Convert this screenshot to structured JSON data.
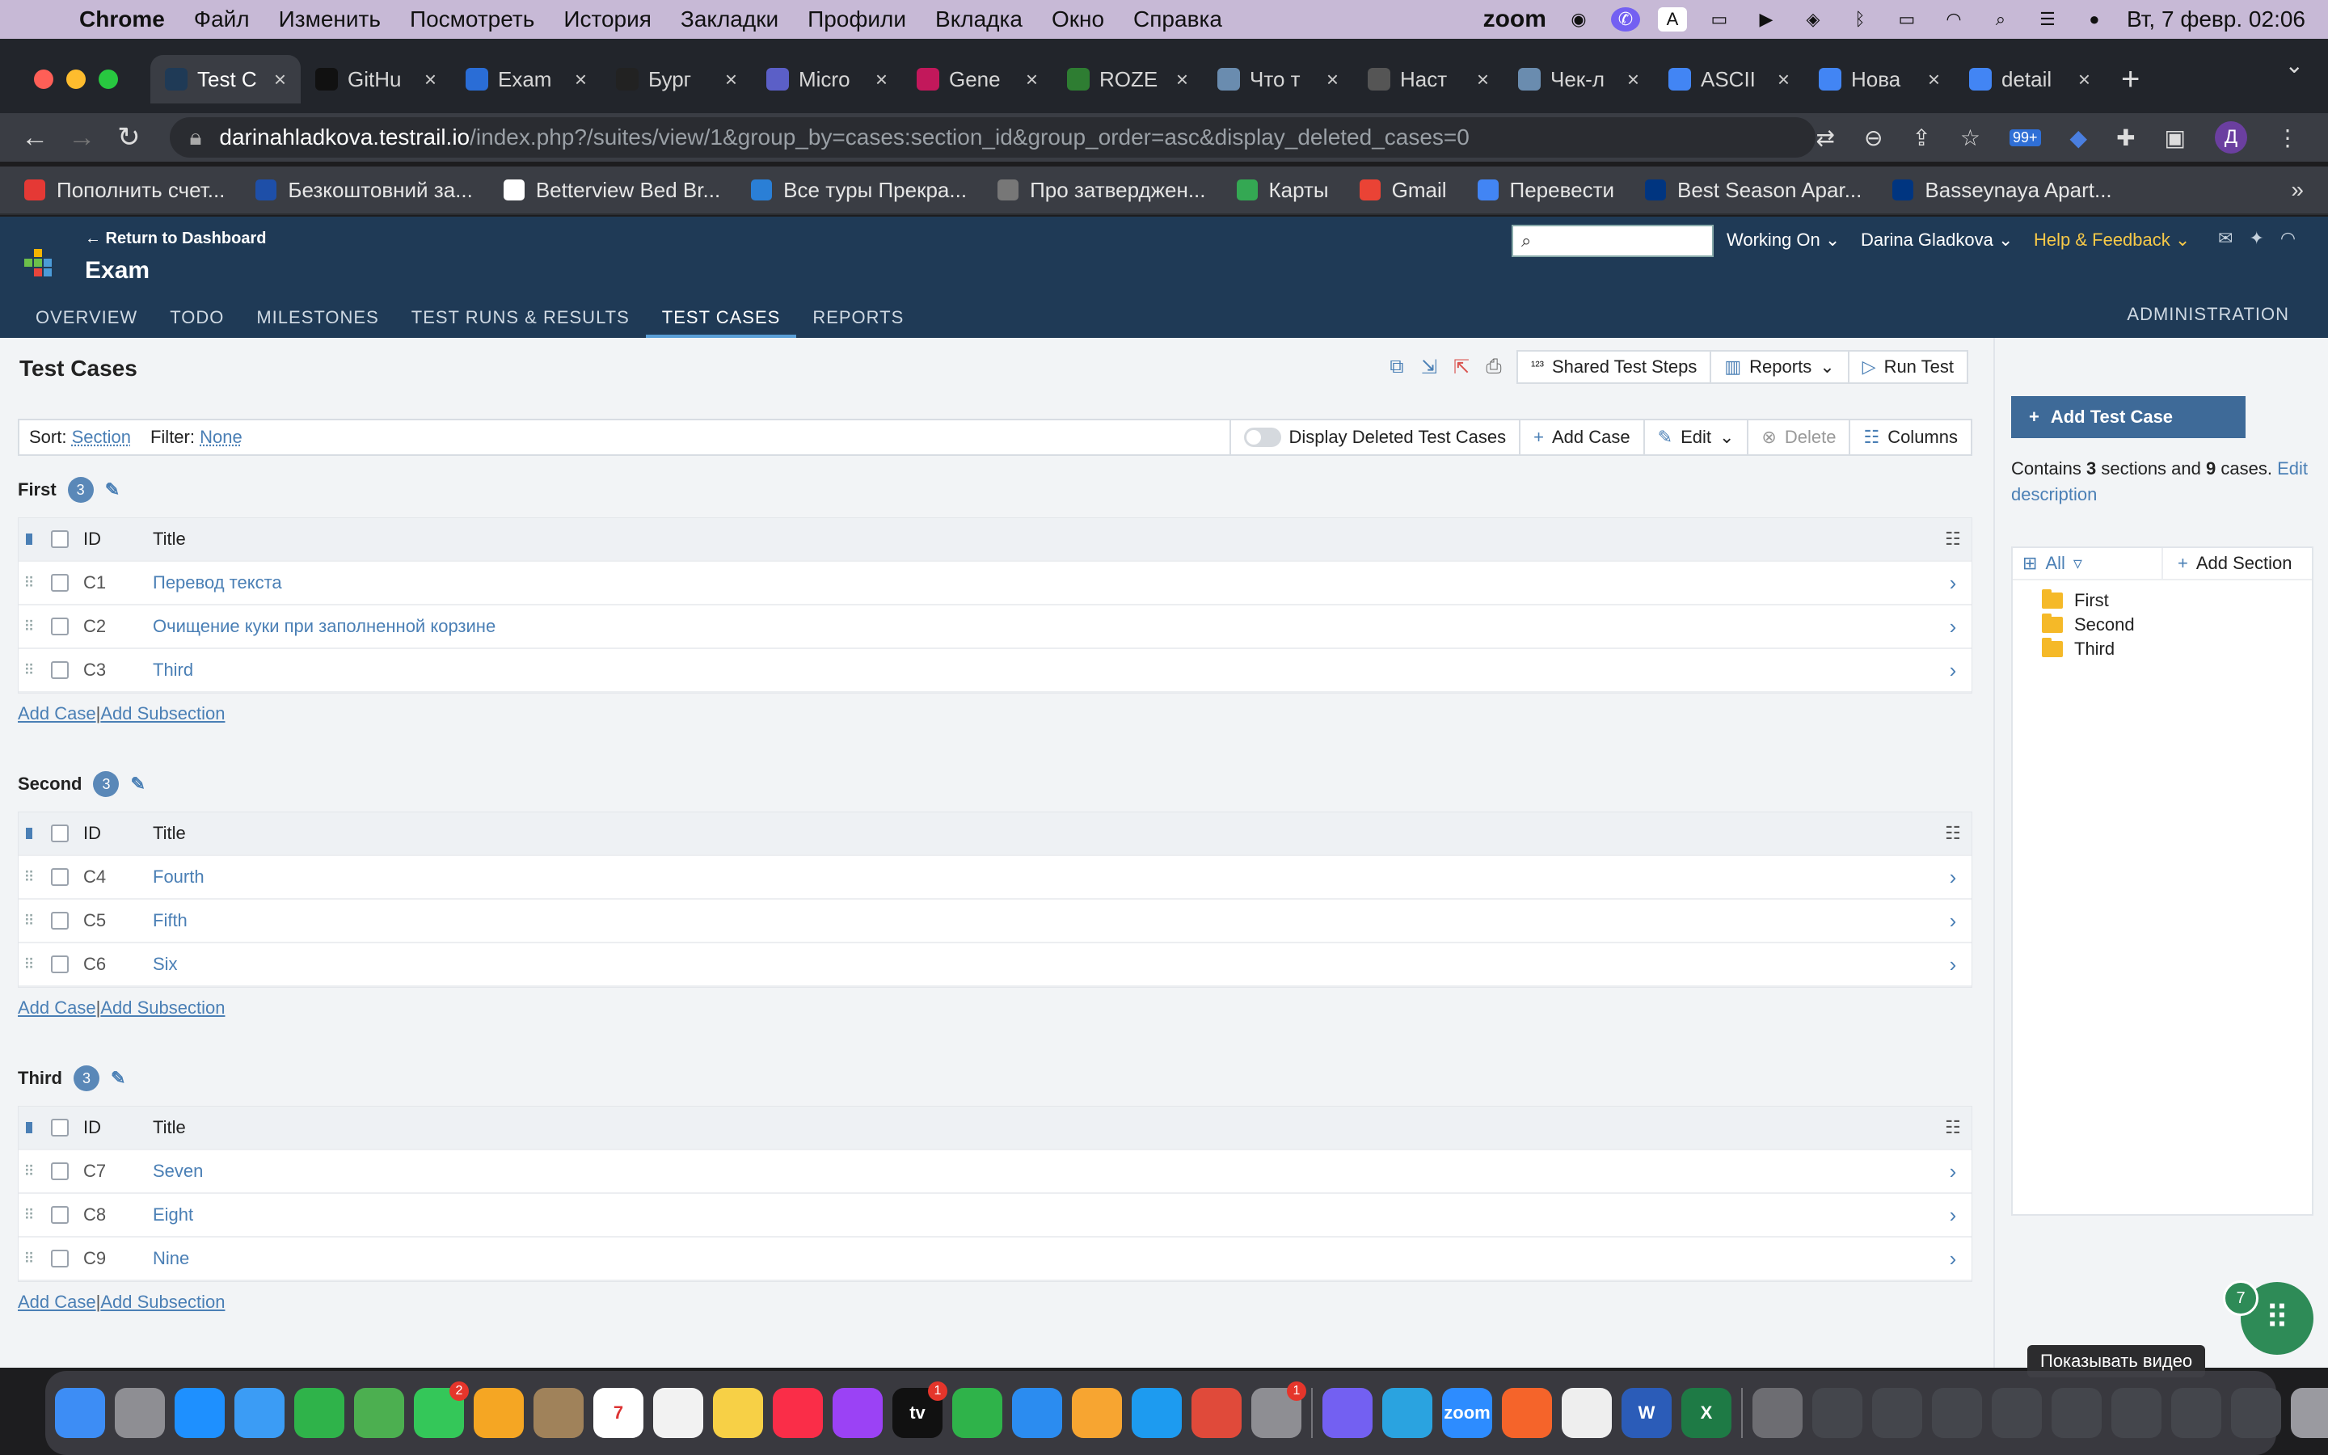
{
  "menubar": {
    "app": "Chrome",
    "items": [
      "Файл",
      "Изменить",
      "Посмотреть",
      "История",
      "Закладки",
      "Профили",
      "Вкладка",
      "Окно",
      "Справка"
    ],
    "zoom": "zoom",
    "datetime": "Вт, 7 февр.  02:06"
  },
  "tabs": [
    {
      "title": "Test C",
      "color": "#1f3a56",
      "active": true
    },
    {
      "title": "GitHu",
      "color": "#111111"
    },
    {
      "title": "Exam",
      "color": "#2a6dd6"
    },
    {
      "title": "Бург",
      "color": "#222222"
    },
    {
      "title": "Micro",
      "color": "#5b5fc7"
    },
    {
      "title": "Gene",
      "color": "#c2185b"
    },
    {
      "title": "ROZE",
      "color": "#2e7d32"
    },
    {
      "title": "Что т",
      "color": "#6a8caf"
    },
    {
      "title": "Наст",
      "color": "#555555"
    },
    {
      "title": "Чек-л",
      "color": "#6a8caf"
    },
    {
      "title": "ASCII",
      "color": "#4285f4"
    },
    {
      "title": "Нова",
      "color": "#4285f4"
    },
    {
      "title": "detail",
      "color": "#4285f4"
    }
  ],
  "address": {
    "domain": "darinahladkova.testrail.io",
    "path": "/index.php?/suites/view/1&group_by=cases:section_id&group_order=asc&display_deleted_cases=0",
    "badge": "99+",
    "profile_initial": "Д"
  },
  "bookmarks": [
    {
      "label": "Пополнить счет...",
      "color": "#e53935"
    },
    {
      "label": "Безкоштовний за...",
      "color": "#1e4fa8"
    },
    {
      "label": "Betterview Bed Br...",
      "color": "#ffffff"
    },
    {
      "label": "Все туры Прекра...",
      "color": "#2a7fd6"
    },
    {
      "label": "Про затверджен...",
      "color": "#777777"
    },
    {
      "label": "Карты",
      "color": "#34a853"
    },
    {
      "label": "Gmail",
      "color": "#ea4335"
    },
    {
      "label": "Перевести",
      "color": "#4285f4"
    },
    {
      "label": "Best Season Apar...",
      "color": "#003580"
    },
    {
      "label": "Basseynaya Apart...",
      "color": "#003580"
    }
  ],
  "app": {
    "return_link": "← Return to Dashboard",
    "project": "Exam",
    "working_on": "Working On",
    "user": "Darina Gladkova",
    "help": "Help & Feedback",
    "nav": [
      "OVERVIEW",
      "TODO",
      "MILESTONES",
      "TEST RUNS & RESULTS",
      "TEST CASES",
      "REPORTS"
    ],
    "active_nav": 4,
    "admin": "ADMINISTRATION"
  },
  "page": {
    "title": "Test Cases",
    "toolbar": {
      "shared_steps": "Shared Test Steps",
      "reports": "Reports",
      "run_test": "Run Test"
    },
    "filter": {
      "sort_label": "Sort:",
      "sort_value": "Section",
      "filter_label": "Filter:",
      "filter_value": "None",
      "display_deleted": "Display Deleted Test Cases",
      "add_case": "Add Case",
      "edit": "Edit",
      "delete": "Delete",
      "columns": "Columns"
    }
  },
  "table_header": {
    "id": "ID",
    "title": "Title"
  },
  "section_links": {
    "add_case": "Add Case",
    "add_subsection": "Add Subsection",
    "sep": "|"
  },
  "sections": [
    {
      "name": "First",
      "count": "3",
      "cases": [
        {
          "id": "C1",
          "title": "Перевод текста"
        },
        {
          "id": "C2",
          "title": "Очищение куки при заполненной корзине"
        },
        {
          "id": "C3",
          "title": "Third"
        }
      ]
    },
    {
      "name": "Second",
      "count": "3",
      "cases": [
        {
          "id": "C4",
          "title": "Fourth"
        },
        {
          "id": "C5",
          "title": "Fifth"
        },
        {
          "id": "C6",
          "title": "Six"
        }
      ]
    },
    {
      "name": "Third",
      "count": "3",
      "cases": [
        {
          "id": "C7",
          "title": "Seven"
        },
        {
          "id": "C8",
          "title": "Eight"
        },
        {
          "id": "C9",
          "title": "Nine"
        }
      ]
    }
  ],
  "sidebar": {
    "add_test_case": "Add Test Case",
    "contains_prefix": "Contains",
    "sections_count": "3",
    "sections_word": "sections and",
    "cases_count": "9",
    "cases_word": "cases.",
    "edit_description": "Edit description",
    "tree_all": "All",
    "add_section": "Add Section",
    "tree": [
      "First",
      "Second",
      "Third"
    ]
  },
  "fab_badge": "7",
  "tooltip": "Показывать видео",
  "dock": [
    {
      "name": "finder",
      "color": "#3d8df5"
    },
    {
      "name": "launchpad",
      "color": "#8e8e93"
    },
    {
      "name": "safari",
      "color": "#1e90ff"
    },
    {
      "name": "mail",
      "color": "#3b9cf5"
    },
    {
      "name": "facetime",
      "color": "#2fb34a"
    },
    {
      "name": "maps",
      "color": "#4caf50"
    },
    {
      "name": "messages",
      "color": "#34c759",
      "badge": "2"
    },
    {
      "name": "photos",
      "color": "#f5a623"
    },
    {
      "name": "contacts",
      "color": "#a0825a"
    },
    {
      "name": "calendar",
      "color": "#ffffff",
      "label": "7"
    },
    {
      "name": "reminders",
      "color": "#f2f2f2"
    },
    {
      "name": "notes",
      "color": "#f7d046"
    },
    {
      "name": "music",
      "color": "#fa2d48"
    },
    {
      "name": "podcasts",
      "color": "#9b42f5"
    },
    {
      "name": "tv",
      "color": "#111111",
      "label": "tv",
      "badge": "1"
    },
    {
      "name": "numbers",
      "color": "#2fb34a"
    },
    {
      "name": "keynote",
      "color": "#2b8cf0"
    },
    {
      "name": "pages",
      "color": "#f7a531"
    },
    {
      "name": "app-store",
      "color": "#1d9bf0"
    },
    {
      "name": "chrome",
      "color": "#e04a3a"
    },
    {
      "name": "system-preferences",
      "color": "#8e8e93",
      "badge": "1"
    },
    {
      "name": "viber",
      "color": "#7360f2"
    },
    {
      "name": "telegram",
      "color": "#2aa3e0"
    },
    {
      "name": "zoom",
      "color": "#2d8cff",
      "label": "zoom"
    },
    {
      "name": "sketch-tool",
      "color": "#f5642a"
    },
    {
      "name": "textedit",
      "color": "#eeeeee"
    },
    {
      "name": "word",
      "color": "#2b5cb8",
      "label": "W"
    },
    {
      "name": "excel",
      "color": "#1e7a45",
      "label": "X"
    },
    {
      "name": "downloads",
      "color": "#6d6d72"
    },
    {
      "name": "window-1",
      "color": "#44464c"
    },
    {
      "name": "window-2",
      "color": "#44464c"
    },
    {
      "name": "window-3",
      "color": "#44464c"
    },
    {
      "name": "window-4",
      "color": "#44464c"
    },
    {
      "name": "window-5",
      "color": "#44464c"
    },
    {
      "name": "window-6",
      "color": "#44464c"
    },
    {
      "name": "window-7",
      "color": "#44464c"
    },
    {
      "name": "window-8",
      "color": "#44464c"
    },
    {
      "name": "trash",
      "color": "#9a9aa0"
    }
  ]
}
